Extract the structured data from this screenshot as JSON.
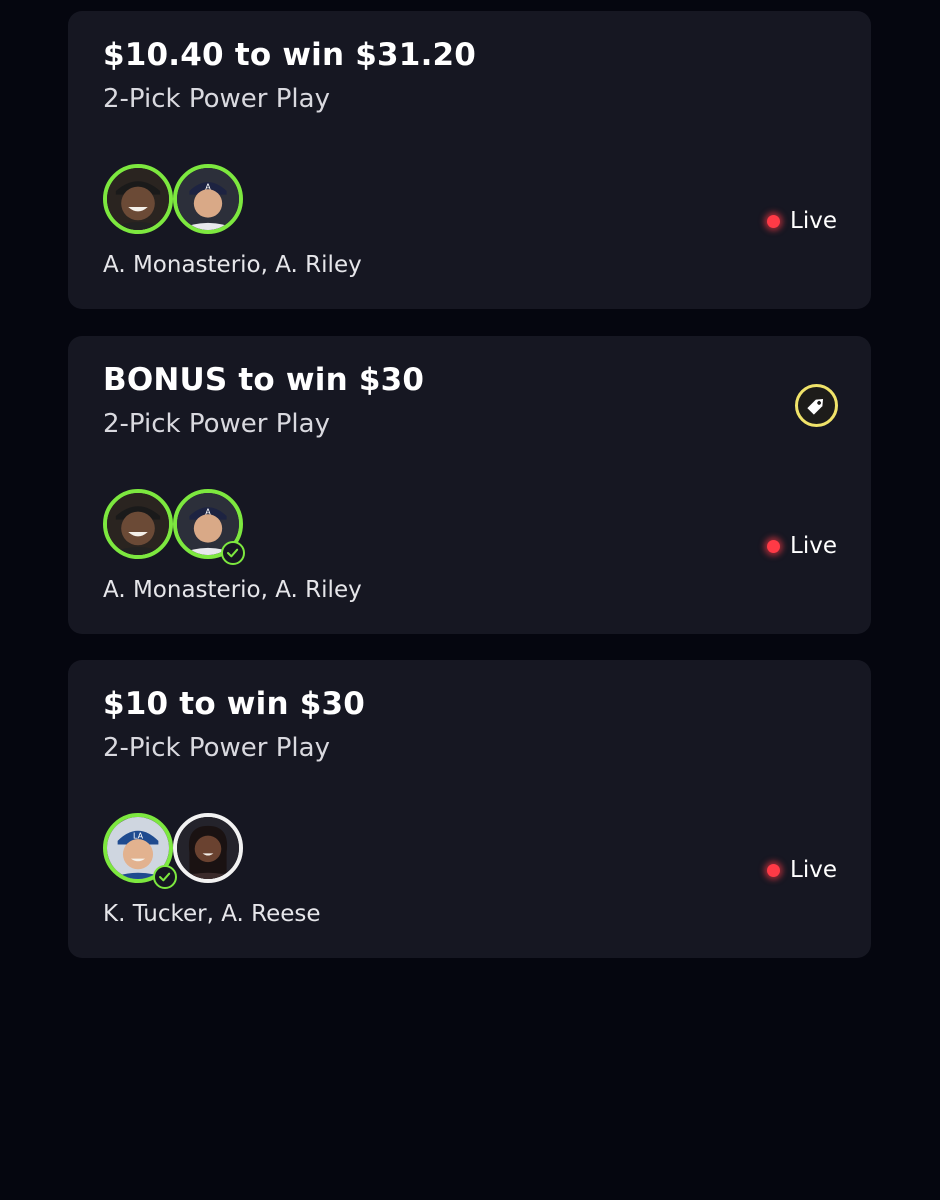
{
  "colors": {
    "background": "#05060f",
    "card": "#161722",
    "accent_green": "#7de83f",
    "live_red": "#ff3a46",
    "promo_yellow": "#f0e36a"
  },
  "entries": [
    {
      "title": "$10.40 to win $31.20",
      "subtitle": "2-Pick Power Play",
      "names": "A. Monasterio, A. Riley",
      "status": "Live",
      "has_promo": false
    },
    {
      "title": "BONUS to win $30",
      "subtitle": "2-Pick Power Play",
      "names": "A. Monasterio, A. Riley",
      "status": "Live",
      "has_promo": true,
      "promo_icon": "tag-icon"
    },
    {
      "title": "$10 to win $30",
      "subtitle": "2-Pick Power Play",
      "names": "K. Tucker, A. Reese",
      "status": "Live",
      "has_promo": false
    }
  ]
}
